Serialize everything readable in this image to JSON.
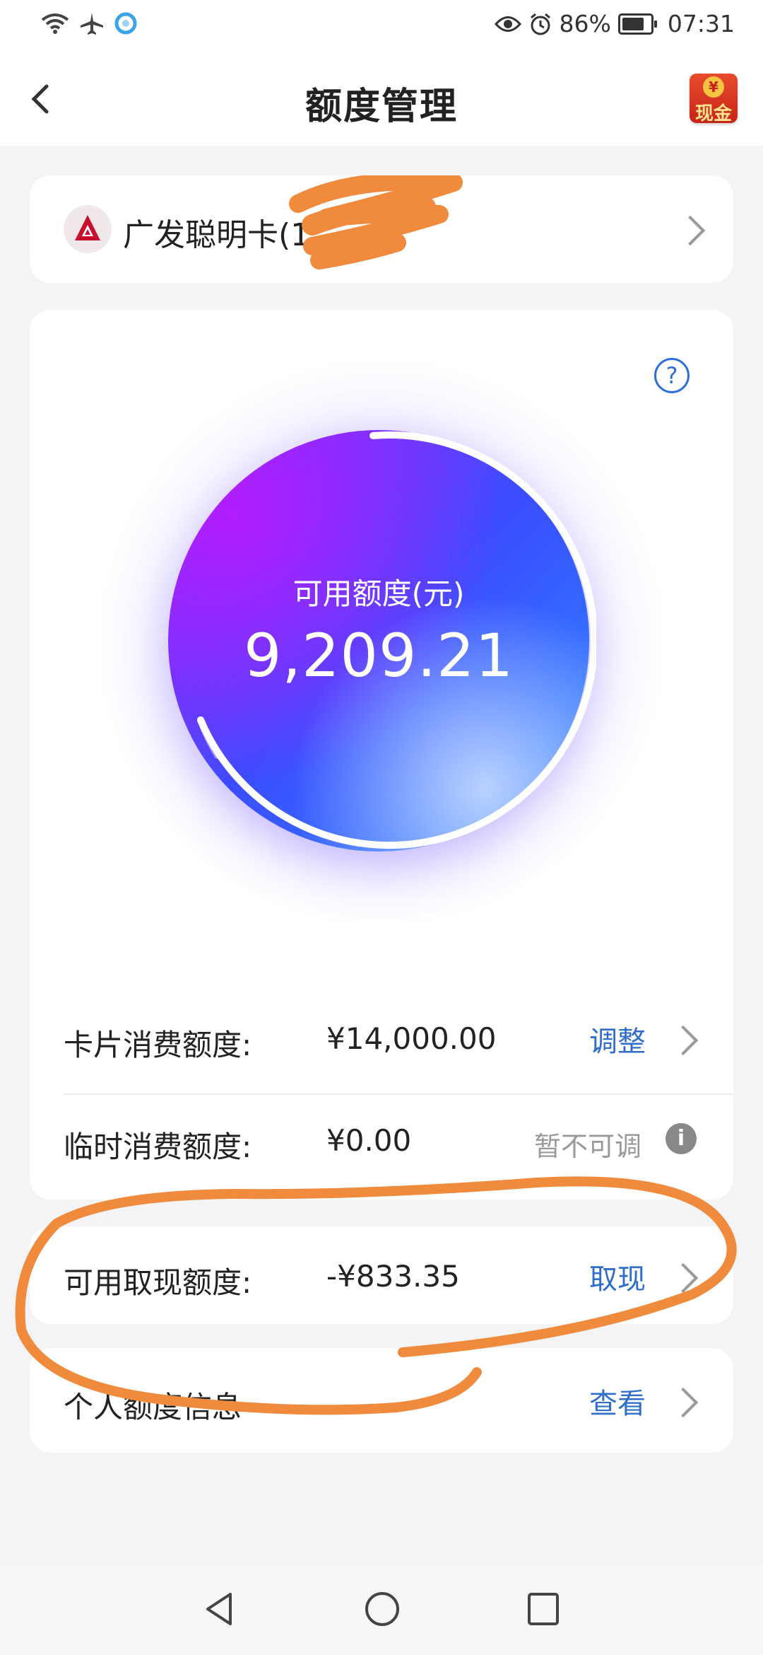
{
  "status_bar": {
    "icons": [
      "wifi-icon",
      "airplane-icon",
      "app-notification-icon"
    ],
    "right_icons": [
      "eye-icon",
      "alarm-icon"
    ],
    "battery": "86%",
    "time": "07:31"
  },
  "header": {
    "title": "额度管理",
    "back_icon": "chevron-left-icon",
    "badge": {
      "coin": "¥",
      "label": "现金"
    }
  },
  "card_select": {
    "name": "广发聪明卡(1",
    "logo_icon": "gf-bank-logo",
    "accent_color": "#c8102e"
  },
  "limit_overview": {
    "label": "可用额度(元)",
    "amount": "9,209.21",
    "help_icon": "question-icon",
    "gradient_colors": [
      "#b21dff",
      "#3b4dff",
      "#2a8bff"
    ]
  },
  "rows": {
    "card_limit": {
      "label": "卡片消费额度:",
      "value": "¥14,000.00",
      "action": "调整"
    },
    "temp_limit": {
      "label": "临时消费额度:",
      "value": "¥0.00",
      "status": "暂不可调",
      "info_icon": "info-icon"
    },
    "cash_limit": {
      "label": "可用取现额度:",
      "value": "-¥833.35",
      "action": "取现"
    },
    "personal": {
      "label": "个人额度信息",
      "action": "查看"
    }
  },
  "annotation_color": "#f08a3c",
  "nav": {
    "icons": [
      "back-triangle-icon",
      "home-circle-icon",
      "recents-square-icon"
    ]
  }
}
